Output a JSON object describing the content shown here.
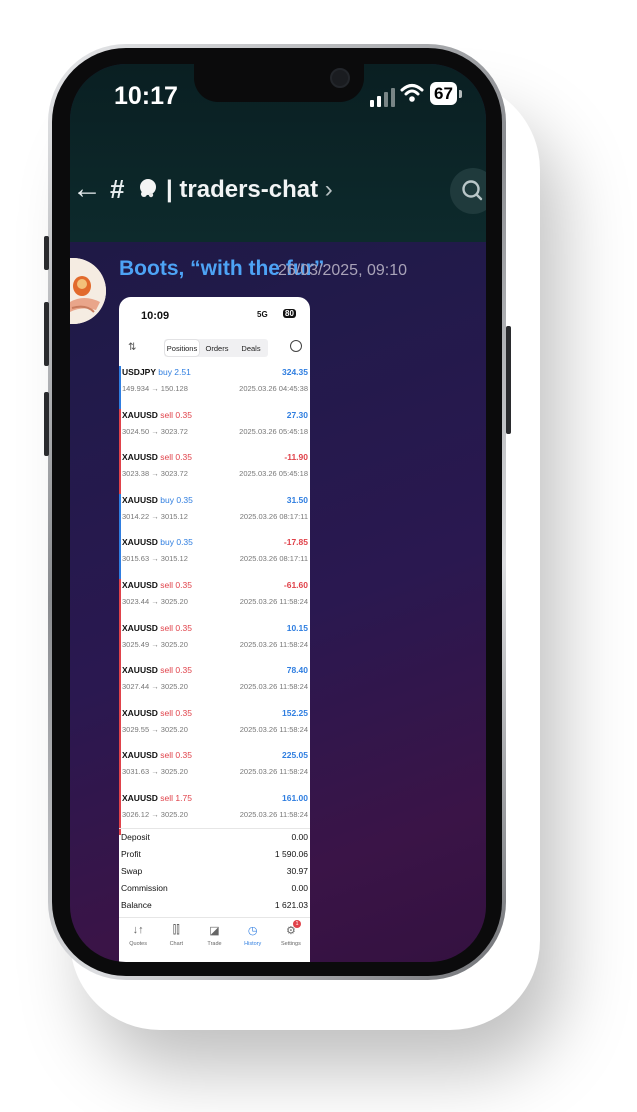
{
  "status_bar": {
    "time": "10:17",
    "battery": "67"
  },
  "header": {
    "back_glyph": "←",
    "hash": "#",
    "channel_separator": "|",
    "channel_name": "traders-chat",
    "chevron": "›"
  },
  "message": {
    "author": "Boots, “with the fur”",
    "timestamp": "26/03/2025, 09:10"
  },
  "attachment": {
    "status_time": "10:09",
    "status_network": "5G",
    "status_battery": "80",
    "tabs": [
      "Positions",
      "Orders",
      "Deals"
    ],
    "active_tab": "Positions",
    "deals": [
      {
        "symbol": "USDJPY",
        "side": "buy 2.51",
        "dir": "buy",
        "prices": "149.934 → 150.128",
        "profit": "324.35",
        "sign": "pos",
        "time": "2025.03.26 04:45:38"
      },
      {
        "symbol": "XAUUSD",
        "side": "sell 0.35",
        "dir": "sell",
        "prices": "3024.50 → 3023.72",
        "profit": "27.30",
        "sign": "pos",
        "time": "2025.03.26 05:45:18"
      },
      {
        "symbol": "XAUUSD",
        "side": "sell 0.35",
        "dir": "sell",
        "prices": "3023.38 → 3023.72",
        "profit": "-11.90",
        "sign": "neg",
        "time": "2025.03.26 05:45:18"
      },
      {
        "symbol": "XAUUSD",
        "side": "buy 0.35",
        "dir": "buy",
        "prices": "3014.22 → 3015.12",
        "profit": "31.50",
        "sign": "pos",
        "time": "2025.03.26 08:17:11"
      },
      {
        "symbol": "XAUUSD",
        "side": "buy 0.35",
        "dir": "buy",
        "prices": "3015.63 → 3015.12",
        "profit": "-17.85",
        "sign": "neg",
        "time": "2025.03.26 08:17:11"
      },
      {
        "symbol": "XAUUSD",
        "side": "sell 0.35",
        "dir": "sell",
        "prices": "3023.44 → 3025.20",
        "profit": "-61.60",
        "sign": "neg",
        "time": "2025.03.26 11:58:24"
      },
      {
        "symbol": "XAUUSD",
        "side": "sell 0.35",
        "dir": "sell",
        "prices": "3025.49 → 3025.20",
        "profit": "10.15",
        "sign": "pos",
        "time": "2025.03.26 11:58:24"
      },
      {
        "symbol": "XAUUSD",
        "side": "sell 0.35",
        "dir": "sell",
        "prices": "3027.44 → 3025.20",
        "profit": "78.40",
        "sign": "pos",
        "time": "2025.03.26 11:58:24"
      },
      {
        "symbol": "XAUUSD",
        "side": "sell 0.35",
        "dir": "sell",
        "prices": "3029.55 → 3025.20",
        "profit": "152.25",
        "sign": "pos",
        "time": "2025.03.26 11:58:24"
      },
      {
        "symbol": "XAUUSD",
        "side": "sell 0.35",
        "dir": "sell",
        "prices": "3031.63 → 3025.20",
        "profit": "225.05",
        "sign": "pos",
        "time": "2025.03.26 11:58:24"
      },
      {
        "symbol": "XAUUSD",
        "side": "sell 1.75",
        "dir": "sell",
        "prices": "3026.12 → 3025.20",
        "profit": "161.00",
        "sign": "pos",
        "time": "2025.03.26 11:58:24"
      }
    ],
    "summary": [
      {
        "label": "Deposit",
        "value": "0.00"
      },
      {
        "label": "Profit",
        "value": "1 590.06"
      },
      {
        "label": "Swap",
        "value": "30.97"
      },
      {
        "label": "Commission",
        "value": "0.00"
      },
      {
        "label": "Balance",
        "value": "1 621.03"
      }
    ],
    "nav": [
      {
        "label": "Quotes",
        "icon": "quotes-icon",
        "glyph": "↓↑",
        "active": false
      },
      {
        "label": "Chart",
        "icon": "chart-icon",
        "glyph": "⫿⫿",
        "active": false
      },
      {
        "label": "Trade",
        "icon": "trade-icon",
        "glyph": "◪",
        "active": false
      },
      {
        "label": "History",
        "icon": "history-icon",
        "glyph": "◷",
        "active": true
      },
      {
        "label": "Settings",
        "icon": "settings-icon",
        "glyph": "⚙",
        "active": false,
        "badge": "1"
      }
    ]
  },
  "colors": {
    "buy": "#2f7ee0",
    "sell": "#e0424a",
    "author": "#4da3f5",
    "header_bg": "#0a1f22"
  }
}
